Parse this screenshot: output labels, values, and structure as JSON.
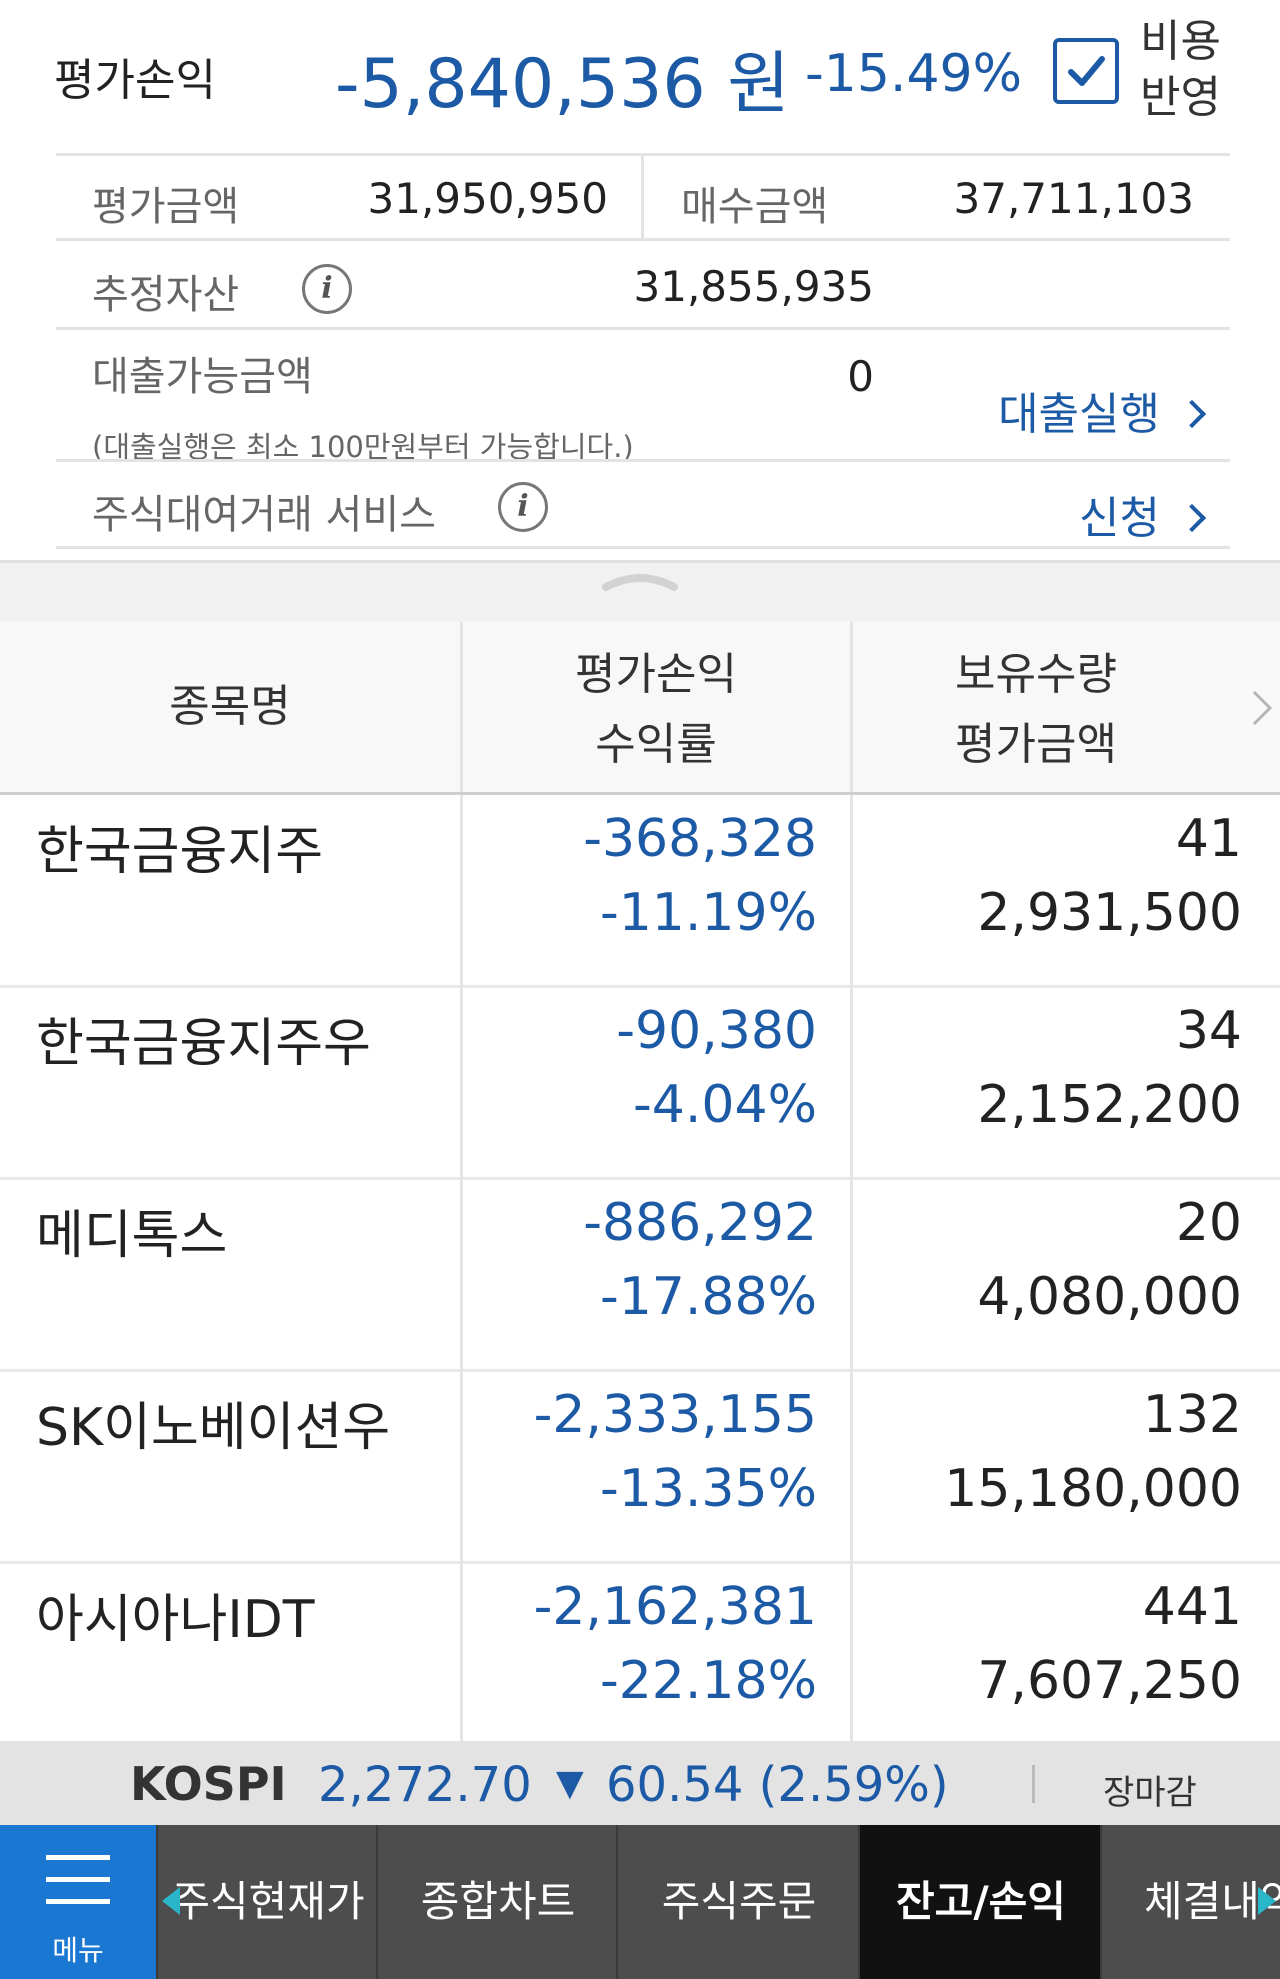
{
  "summary": {
    "eval_pl_label": "평가손익",
    "eval_pl_value": "-5,840,536 원",
    "eval_pl_rate": "-15.49%",
    "cost_reflect_line1": "비용",
    "cost_reflect_line2": "반영",
    "cost_reflect_checked": true,
    "eval_amount_label": "평가금액",
    "eval_amount_value": "31,950,950",
    "purchase_amount_label": "매수금액",
    "purchase_amount_value": "37,711,103",
    "est_assets_label": "추정자산",
    "est_assets_value": "31,855,935",
    "loan_label": "대출가능금액",
    "loan_value": "0",
    "loan_note": "(대출실행은 최소 100만원부터 가능합니다.)",
    "loan_action": "대출실행",
    "lending_label": "주식대여거래 서비스",
    "lending_action": "신청"
  },
  "table": {
    "col_name": "종목명",
    "col_pl_line1": "평가손익",
    "col_pl_line2": "수익률",
    "col_qty_line1": "보유수량",
    "col_qty_line2": "평가금액",
    "rows": [
      {
        "name": "한국금융지주",
        "pl": "-368,328",
        "rate": "-11.19%",
        "qty": "41",
        "amount": "2,931,500"
      },
      {
        "name": "한국금융지주우",
        "pl": "-90,380",
        "rate": "-4.04%",
        "qty": "34",
        "amount": "2,152,200"
      },
      {
        "name": "메디톡스",
        "pl": "-886,292",
        "rate": "-17.88%",
        "qty": "20",
        "amount": "4,080,000"
      },
      {
        "name": "SK이노베이션우",
        "pl": "-2,333,155",
        "rate": "-13.35%",
        "qty": "132",
        "amount": "15,180,000"
      },
      {
        "name": "아시아나IDT",
        "pl": "-2,162,381",
        "rate": "-22.18%",
        "qty": "441",
        "amount": "7,607,250"
      }
    ]
  },
  "ticker": {
    "index_name": "KOSPI",
    "index_value": "2,272.70",
    "change_arrow": "▼",
    "change": "60.54 (2.59%)",
    "market_status": "장마감"
  },
  "nav": {
    "menu_label": "메뉴",
    "items": [
      "주식현재가",
      "종합차트",
      "주식주문",
      "잔고/손익",
      "체결내역"
    ],
    "active_index": 3
  },
  "colors": {
    "accent_blue": "#1c5aa6",
    "menu_blue": "#1a78d2",
    "nav_bg": "#4d4d4d",
    "nav_active_bg": "#111111"
  }
}
